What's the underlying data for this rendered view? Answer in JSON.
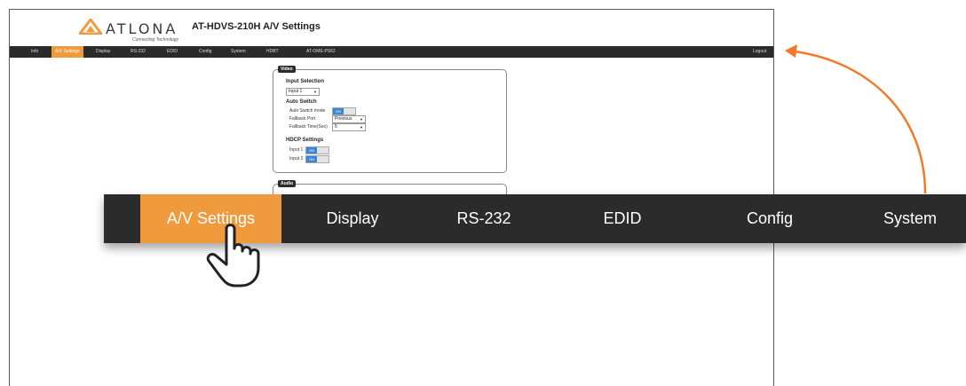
{
  "brand": {
    "name": "ATLONA",
    "tagline": "Connecting Technology",
    "accent_color": "#f09a3e"
  },
  "page_title": "AT-HDVS-210H  A/V Settings",
  "nav": {
    "items": [
      "Info",
      "A/V Settings",
      "Display",
      "RS-232",
      "EDID",
      "Config",
      "System",
      "HDBT",
      "AT-OME-PS62"
    ],
    "active": "A/V Settings",
    "logout": "Logout"
  },
  "video_panel": {
    "tag": "Video",
    "input_selection": {
      "title": "Input Selection",
      "value": "Input 1"
    },
    "auto_switch": {
      "title": "Auto Switch",
      "mode_label": "Auto Switch mode",
      "mode_value": "ON",
      "fallback_port_label": "Fallback Port",
      "fallback_port_value": "Previous",
      "fallback_time_label": "Fallback Time(Sec)",
      "fallback_time_value": "5"
    },
    "hdcp": {
      "title": "HDCP Settings",
      "input1_label": "Input 1",
      "input1_value": "ON",
      "input2_label": "Input 2",
      "input2_value": "ON"
    }
  },
  "audio_panel": {
    "tag": "Audio"
  },
  "zoom_nav": {
    "items": [
      "A/V Settings",
      "Display",
      "RS-232",
      "EDID",
      "Config",
      "System"
    ],
    "active": "A/V Settings"
  },
  "icons": [
    "atlona-logo-icon",
    "hand-cursor-icon",
    "orange-arrow-icon",
    "dropdown-caret-icon"
  ]
}
